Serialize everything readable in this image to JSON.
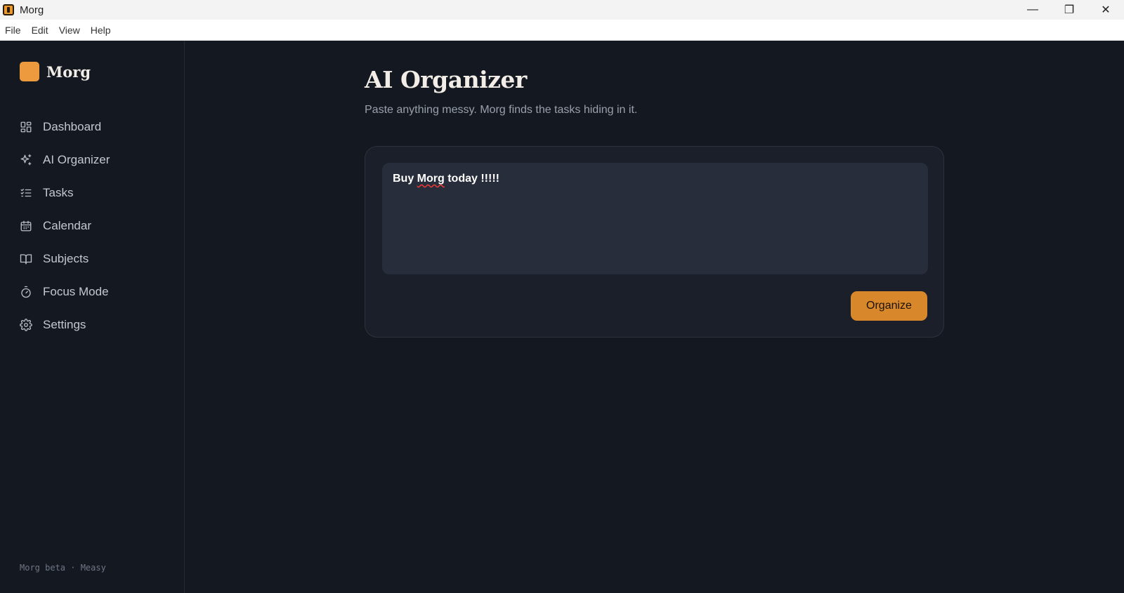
{
  "window": {
    "title": "Morg",
    "controls": {
      "minimize": "—",
      "maximize": "❐",
      "close": "✕"
    }
  },
  "menubar": [
    "File",
    "Edit",
    "View",
    "Help"
  ],
  "sidebar": {
    "brand": "Morg",
    "items": [
      {
        "label": "Dashboard",
        "icon": "dashboard-icon"
      },
      {
        "label": "AI Organizer",
        "icon": "sparkles-icon"
      },
      {
        "label": "Tasks",
        "icon": "tasks-icon"
      },
      {
        "label": "Calendar",
        "icon": "calendar-icon"
      },
      {
        "label": "Subjects",
        "icon": "book-icon"
      },
      {
        "label": "Focus Mode",
        "icon": "timer-icon"
      },
      {
        "label": "Settings",
        "icon": "gear-icon"
      }
    ],
    "footer": "Morg beta · Measy"
  },
  "main": {
    "title": "AI Organizer",
    "subtitle": "Paste anything messy. Morg finds the tasks hiding in it.",
    "input": {
      "value_before": "Buy ",
      "value_misspelled": "Morg",
      "value_after": " today !!!!!"
    },
    "organize_label": "Organize"
  },
  "colors": {
    "accent": "#d8872b",
    "brand": "#ec9a3d",
    "background": "#141821",
    "card": "#1a1f29",
    "input": "#272d3b"
  }
}
